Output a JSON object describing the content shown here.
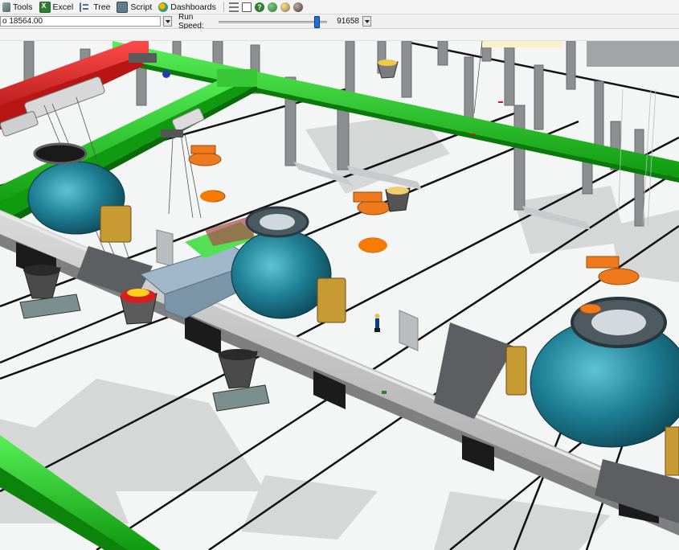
{
  "toolbar": {
    "items": [
      {
        "label": "Tools"
      },
      {
        "label": "Excel"
      },
      {
        "label": "Tree"
      },
      {
        "label": "Script"
      },
      {
        "label": "Dashboards"
      }
    ]
  },
  "runbar": {
    "time_prefix": "o",
    "time_value": "18564.00",
    "speed_label": "Run Speed:",
    "speed_value": "91658",
    "slider_fraction": 0.93
  },
  "colors": {
    "crane_green": "#1fc21f",
    "crane_red": "#d41e1e",
    "vessel_teal": "#2b8aa0",
    "ladle_orange": "#ef7a1e",
    "floor": "#f3f4f4",
    "platform": "#cfcfcf"
  },
  "viewport": {
    "figure_label": "worker"
  }
}
